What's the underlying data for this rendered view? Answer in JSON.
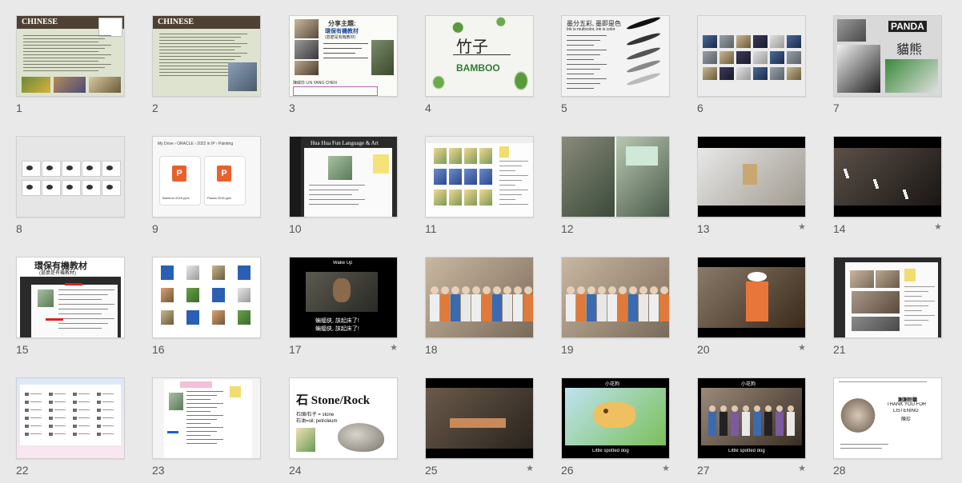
{
  "window": {
    "background": "#e9e9e9"
  },
  "slides": [
    {
      "number": "1",
      "animated": false,
      "style": "chinese-title",
      "title": "CHINESE"
    },
    {
      "number": "2",
      "animated": false,
      "style": "chinese-body",
      "title": "CHINESE"
    },
    {
      "number": "3",
      "animated": false,
      "style": "topic-cn",
      "title": "分享主題:",
      "line1": "環保有機教材",
      "line2": "(甚麼是有機教材)",
      "caption": "陳綵珍 LIN YANG CHEN"
    },
    {
      "number": "4",
      "animated": false,
      "style": "bamboo",
      "title": "竹子",
      "subtitle": "BAMBOO"
    },
    {
      "number": "5",
      "animated": false,
      "style": "ink",
      "title": "墨分五彩, 墨即是色",
      "subtitle": "Ink is multicolor, ink is color"
    },
    {
      "number": "6",
      "animated": false,
      "style": "photo-grid"
    },
    {
      "number": "7",
      "animated": false,
      "style": "panda",
      "title": "PANDA",
      "subtitle": "貓熊"
    },
    {
      "number": "8",
      "animated": false,
      "style": "sketches"
    },
    {
      "number": "9",
      "animated": false,
      "style": "drive",
      "path": "My Drive › ORACLE › 2022 in IP › Painting",
      "files": [
        "Bamboo 2016.pptx",
        "Panda 2016.pptx"
      ]
    },
    {
      "number": "10",
      "animated": false,
      "style": "site",
      "title": "Hua Hua Fun Language & Art"
    },
    {
      "number": "11",
      "animated": false,
      "style": "site-grid"
    },
    {
      "number": "12",
      "animated": false,
      "style": "classroom"
    },
    {
      "number": "13",
      "animated": true,
      "style": "video-light"
    },
    {
      "number": "14",
      "animated": true,
      "style": "video-dark"
    },
    {
      "number": "15",
      "animated": false,
      "style": "site-cn",
      "title": "環保有機教材",
      "subtitle": "(甚麼是有機教材)"
    },
    {
      "number": "16",
      "animated": false,
      "style": "files"
    },
    {
      "number": "17",
      "animated": true,
      "style": "wakeup",
      "title": "Wake Up",
      "line1": "蝙蝠俠, 該起床了!",
      "line2": "蝙蝠俠, 該起床了!"
    },
    {
      "number": "18",
      "animated": false,
      "style": "group"
    },
    {
      "number": "19",
      "animated": false,
      "style": "group"
    },
    {
      "number": "20",
      "animated": true,
      "style": "chefs"
    },
    {
      "number": "21",
      "animated": false,
      "style": "site-photos"
    },
    {
      "number": "22",
      "animated": false,
      "style": "folders"
    },
    {
      "number": "23",
      "animated": false,
      "style": "site-list"
    },
    {
      "number": "24",
      "animated": false,
      "style": "stone",
      "title": "石 Stone/Rock",
      "line1": "石頭/石子 = stone",
      "line2": "石油=oil; petroleum"
    },
    {
      "number": "25",
      "animated": true,
      "style": "room"
    },
    {
      "number": "26",
      "animated": true,
      "style": "cartoon",
      "title": "小花狗",
      "subtitle": "Little spotted dog"
    },
    {
      "number": "27",
      "animated": true,
      "style": "group-caption",
      "title": "小花狗",
      "subtitle": "Little spotted dog"
    },
    {
      "number": "28",
      "animated": false,
      "style": "thanks",
      "line1": "謝謝聆聽",
      "line2": "THANK YOU FOR",
      "line3": "LISTENING",
      "line4": "陳珍"
    }
  ],
  "icons": {
    "animation": "star-icon"
  },
  "animation_glyph": "★"
}
